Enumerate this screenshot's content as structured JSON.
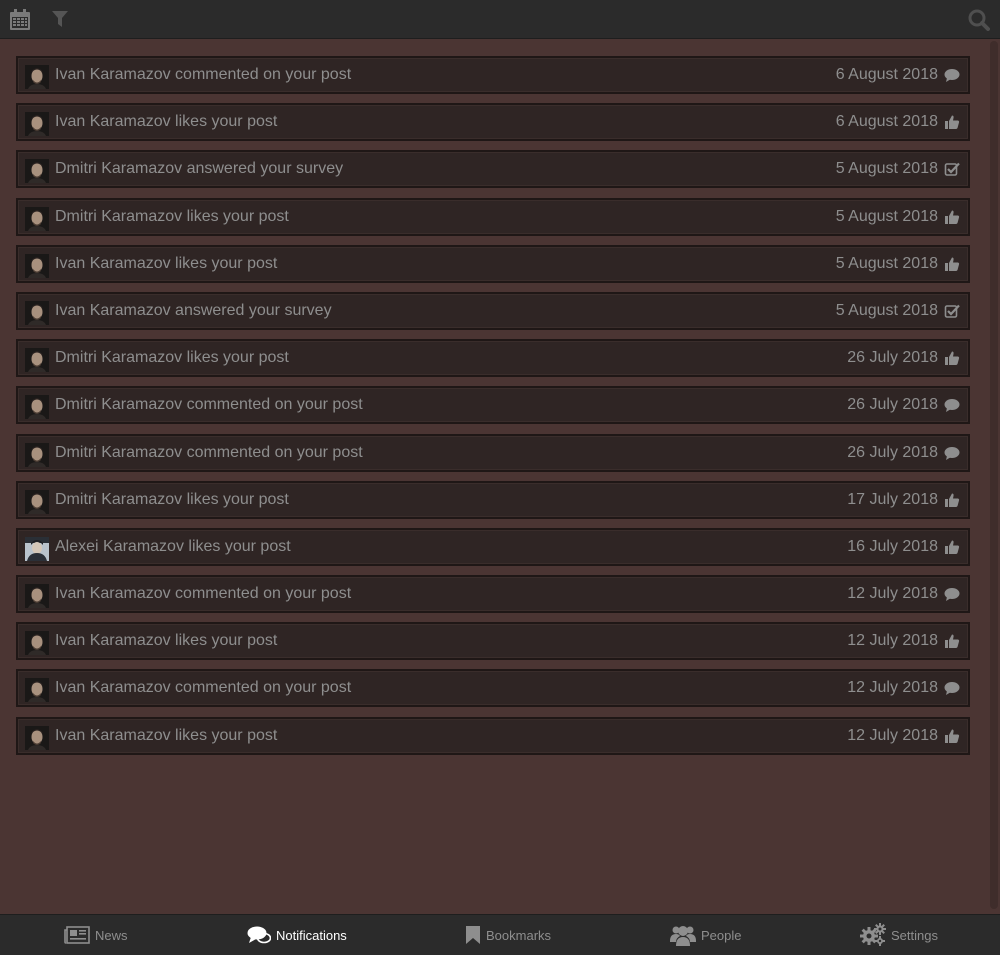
{
  "colors": {
    "background": "#4b3533",
    "bar": "#2b2b2b",
    "row": "#2f2524",
    "text": "#8e8e8e",
    "active": "#ffffff"
  },
  "topbar": {
    "icons": [
      "calendar-icon",
      "filter-icon",
      "search-icon"
    ]
  },
  "notifications": [
    {
      "text": "Ivan Karamazov commented on your post",
      "date": "6 August 2018",
      "icon": "comment-icon"
    },
    {
      "text": "Ivan Karamazov likes your post",
      "date": "6 August 2018",
      "icon": "thumbs-up-icon"
    },
    {
      "text": "Dmitri Karamazov answered your survey",
      "date": "5 August 2018",
      "icon": "check-square-icon"
    },
    {
      "text": "Dmitri Karamazov likes your post",
      "date": "5 August 2018",
      "icon": "thumbs-up-icon"
    },
    {
      "text": "Ivan Karamazov likes your post",
      "date": "5 August 2018",
      "icon": "thumbs-up-icon"
    },
    {
      "text": "Ivan Karamazov answered your survey",
      "date": "5 August 2018",
      "icon": "check-square-icon"
    },
    {
      "text": "Dmitri Karamazov likes your post",
      "date": "26 July 2018",
      "icon": "thumbs-up-icon"
    },
    {
      "text": "Dmitri Karamazov commented on your post",
      "date": "26 July 2018",
      "icon": "comment-icon"
    },
    {
      "text": "Dmitri Karamazov commented on your post",
      "date": "26 July 2018",
      "icon": "comment-icon"
    },
    {
      "text": "Dmitri Karamazov likes your post",
      "date": "17 July 2018",
      "icon": "thumbs-up-icon"
    },
    {
      "text": "Alexei Karamazov likes your post",
      "date": "16 July 2018",
      "icon": "thumbs-up-icon"
    },
    {
      "text": "Ivan Karamazov commented on your post",
      "date": "12 July 2018",
      "icon": "comment-icon"
    },
    {
      "text": "Ivan Karamazov likes your post",
      "date": "12 July 2018",
      "icon": "thumbs-up-icon"
    },
    {
      "text": "Ivan Karamazov commented on your post",
      "date": "12 July 2018",
      "icon": "comment-icon"
    },
    {
      "text": "Ivan Karamazov likes your post",
      "date": "12 July 2018",
      "icon": "thumbs-up-icon"
    }
  ],
  "bottom_nav": [
    {
      "label": "News",
      "icon": "newspaper-icon",
      "active": false
    },
    {
      "label": "Notifications",
      "icon": "comments-icon",
      "active": true
    },
    {
      "label": "Bookmarks",
      "icon": "bookmark-icon",
      "active": false
    },
    {
      "label": "People",
      "icon": "people-icon",
      "active": false
    },
    {
      "label": "Settings",
      "icon": "gears-icon",
      "active": false
    }
  ]
}
